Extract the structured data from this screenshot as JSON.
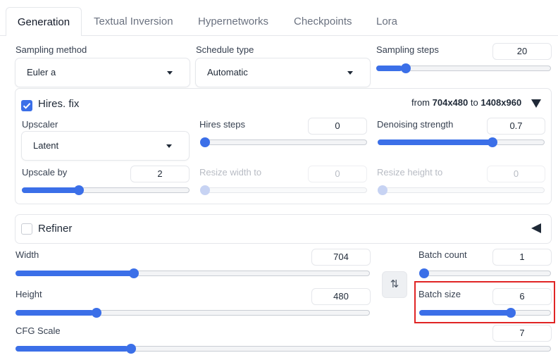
{
  "tabs": [
    {
      "label": "Generation",
      "active": true
    },
    {
      "label": "Textual Inversion"
    },
    {
      "label": "Hypernetworks"
    },
    {
      "label": "Checkpoints"
    },
    {
      "label": "Lora"
    }
  ],
  "sampling_method": {
    "label": "Sampling method",
    "value": "Euler a"
  },
  "schedule_type": {
    "label": "Schedule type",
    "value": "Automatic"
  },
  "sampling_steps": {
    "label": "Sampling steps",
    "value": "20",
    "level": 0.15
  },
  "hires": {
    "label": "Hires. fix",
    "checked": true,
    "summary_from": "from",
    "summary_from_size": "704x480",
    "summary_to": "to",
    "summary_to_size": "1408x960",
    "upscaler": {
      "label": "Upscaler",
      "value": "Latent"
    },
    "hires_steps": {
      "label": "Hires steps",
      "value": "0",
      "level": 0.0
    },
    "denoising": {
      "label": "Denoising strength",
      "value": "0.7",
      "level": 0.7
    },
    "upscale_by": {
      "label": "Upscale by",
      "value": "2",
      "level": 0.33
    },
    "resize_width": {
      "label": "Resize width to",
      "value": "0",
      "level": 0.0
    },
    "resize_height": {
      "label": "Resize height to",
      "value": "0",
      "level": 0.0
    }
  },
  "refiner": {
    "label": "Refiner",
    "checked": false
  },
  "width": {
    "label": "Width",
    "value": "704",
    "level": 0.33
  },
  "height": {
    "label": "Height",
    "value": "480",
    "level": 0.22
  },
  "batch_count": {
    "label": "Batch count",
    "value": "1",
    "level": 0.0
  },
  "batch_size": {
    "label": "Batch size",
    "value": "6",
    "level": 0.71
  },
  "cfg_scale": {
    "label": "CFG Scale",
    "value": "7",
    "level": 0.21
  },
  "swap_icon": "⇅",
  "colors": {
    "accent": "#3b6fe8",
    "highlight": "#e02424"
  }
}
